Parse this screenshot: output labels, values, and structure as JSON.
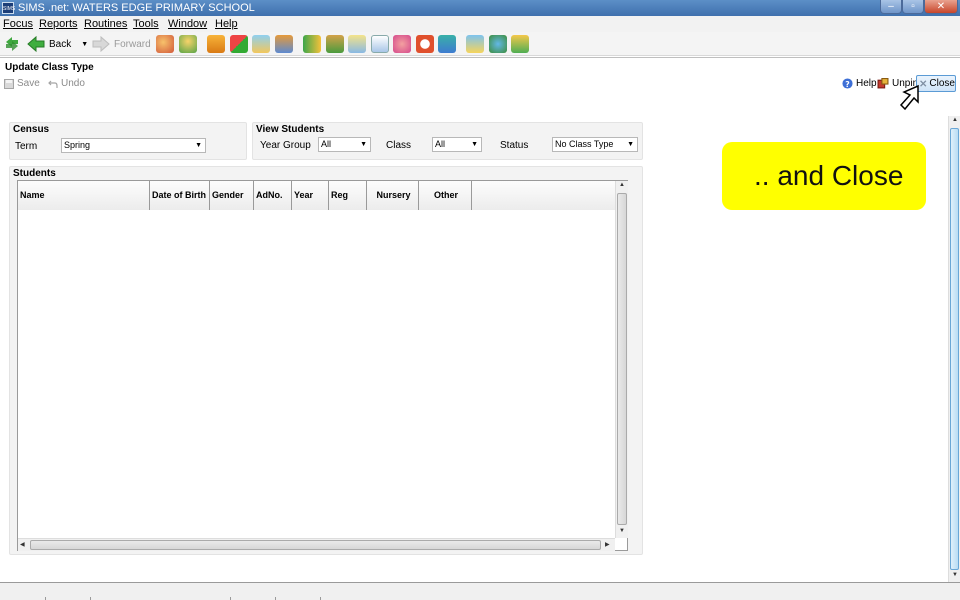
{
  "window": {
    "app_icon_text": "SIMS",
    "title": "SIMS .net: WATERS EDGE PRIMARY SCHOOL",
    "minimize_glyph": "–",
    "maximize_glyph": "▫",
    "close_glyph": "✕"
  },
  "menu": [
    "Focus",
    "Reports",
    "Routines",
    "Tools",
    "Window",
    "Help"
  ],
  "toolbar": {
    "back_label": "Back",
    "forward_label": "Forward"
  },
  "page": {
    "title": "Update Class Type",
    "save_label": "Save",
    "undo_label": "Undo",
    "help_label": "Help",
    "unpin_label": "Unpin",
    "close_label": "Close"
  },
  "census": {
    "title": "Census",
    "term_label": "Term",
    "term_value": "Spring"
  },
  "view_students": {
    "title": "View Students",
    "year_group_label": "Year Group",
    "year_group_value": "All",
    "class_label": "Class",
    "class_value": "All",
    "status_label": "Status",
    "status_value": "No Class Type"
  },
  "students": {
    "title": "Students",
    "columns": [
      "Name",
      "Date of Birth",
      "Gender",
      "AdNo.",
      "Year",
      "Reg",
      "Nursery",
      "Other",
      ""
    ],
    "rows": []
  },
  "callout": {
    "text": ".. and Close"
  },
  "colors": {
    "callout_bg": "#ffff00",
    "titlebar_bg": "#4f80bd",
    "close_highlight": "#cfe4f8"
  }
}
